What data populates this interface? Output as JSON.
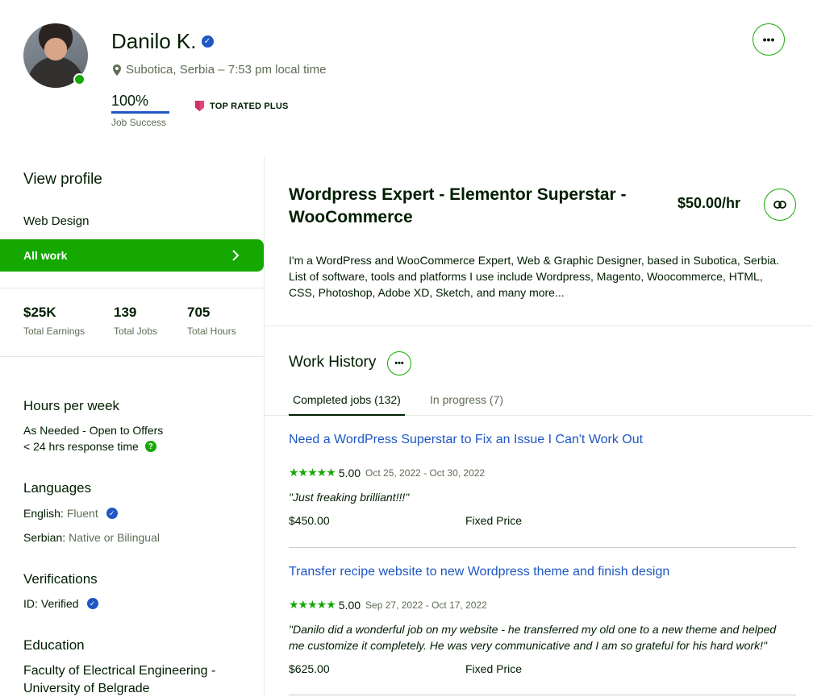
{
  "profile": {
    "name": "Danilo K.",
    "location": "Subotica, Serbia – 7:53 pm local time",
    "job_success_pct": "100%",
    "job_success_label": "Job Success",
    "badge": "TOP RATED PLUS"
  },
  "sidebar": {
    "view_profile": "View profile",
    "category": "Web Design",
    "all_work": "All work",
    "stats": [
      {
        "value": "$25K",
        "label": "Total Earnings"
      },
      {
        "value": "139",
        "label": "Total Jobs"
      },
      {
        "value": "705",
        "label": "Total Hours"
      }
    ],
    "hours_heading": "Hours per week",
    "hours_value": "As Needed - Open to Offers",
    "response_time": "< 24 hrs response time",
    "languages_heading": "Languages",
    "languages": [
      {
        "name": "English:",
        "level": "Fluent"
      },
      {
        "name": "Serbian:",
        "level": "Native or Bilingual"
      }
    ],
    "verifications_heading": "Verifications",
    "id_label": "ID:",
    "id_value": "Verified",
    "education_heading": "Education",
    "education_line1": "Faculty of Electrical Engineering -",
    "education_line2": "University of Belgrade"
  },
  "main": {
    "title_line1": "Wordpress Expert - Elementor Superstar -",
    "title_line2": "WooCommerce",
    "rate": "$50.00/hr",
    "description_line1": "I'm a WordPress and WooCommerce Expert, Web & Graphic Designer, based in Subotica, Serbia.",
    "description_line2": "List of software, tools and platforms I use include Wordpress, Magento, Woocommerce, HTML,",
    "description_line3": "CSS, Photoshop, Adobe XD, Sketch, and many more...",
    "work_history_title": "Work History",
    "tabs": [
      {
        "label": "Completed jobs (132)"
      },
      {
        "label": "In progress (7)"
      }
    ],
    "jobs": [
      {
        "title": "Need a WordPress Superstar to Fix an Issue I Can't Work Out",
        "stars": "★★★★★",
        "score": "5.00",
        "dates": "Oct 25, 2022 - Oct 30, 2022",
        "quote_line1": "\"Just freaking brilliant!!!\"",
        "quote_line2": "",
        "price": "$450.00",
        "price_type": "Fixed Price"
      },
      {
        "title": "Transfer recipe website to new Wordpress theme and finish design",
        "stars": "★★★★★",
        "score": "5.00",
        "dates": "Sep 27, 2022 - Oct 17, 2022",
        "quote_line1": "\"Danilo did a wonderful job on my website - he transferred my old one to a new theme and helped",
        "quote_line2": "me customize it completely. He was very communicative and I am so grateful for his hard work!\"",
        "price": "$625.00",
        "price_type": "Fixed Price"
      }
    ]
  },
  "icons": {
    "verified": "verified-check-icon",
    "location": "map-pin-icon",
    "top_rated": "top-rated-badge-icon",
    "more": "more-dots-icon",
    "link": "link-icon",
    "chevron": "chevron-right-icon",
    "help": "question-circle-icon"
  },
  "colors": {
    "accent_green": "#14a800",
    "link_blue": "#1f57c3",
    "text_dark": "#001e00",
    "text_muted": "#5e6d55",
    "badge_pink": "#e0457b"
  }
}
